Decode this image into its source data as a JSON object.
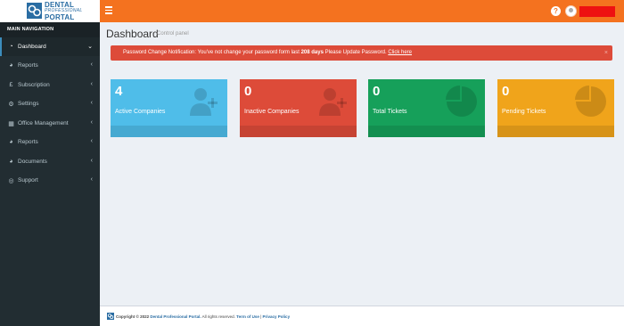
{
  "brand": {
    "line1": "DENTAL",
    "line2": "PROFESSIONAL",
    "line3": "PORTAL"
  },
  "topbar": {
    "help_symbol": "?",
    "accent_color": "#f4721f"
  },
  "sidebar": {
    "header": "MAIN NAVIGATION",
    "items": [
      {
        "label": "Dashboard",
        "icon": "dashboard-icon"
      },
      {
        "label": "Reports",
        "icon": "pie-chart-icon"
      },
      {
        "label": "Subscription",
        "icon": "pound-icon"
      },
      {
        "label": "Settings",
        "icon": "gear-icon"
      },
      {
        "label": "Office Management",
        "icon": "building-icon"
      },
      {
        "label": "Reports",
        "icon": "pie-chart-icon"
      },
      {
        "label": "Documents",
        "icon": "pie-chart-icon"
      },
      {
        "label": "Support",
        "icon": "life-ring-icon"
      }
    ]
  },
  "page": {
    "title": "Dashboard",
    "subtitle": "Control panel"
  },
  "alert": {
    "text_before": "Password Change Notification: You've not change your password form last ",
    "days": "208 days",
    "text_after": " Please Update Password. ",
    "link": "Click here",
    "close": "×"
  },
  "stats": [
    {
      "value": "4",
      "label": "Active Companies",
      "color": "#4fbde9"
    },
    {
      "value": "0",
      "label": "Inactive Companies",
      "color": "#dd4b39"
    },
    {
      "value": "0",
      "label": "Total Tickets",
      "color": "#16a05a"
    },
    {
      "value": "0",
      "label": "Pending Tickets",
      "color": "#f0a41b"
    }
  ],
  "footer": {
    "copyright": "Copyright © 2022",
    "company": "Dental Professional Portal.",
    "rights": "All rights reserved.",
    "terms": "Term of Use",
    "separator": "|",
    "privacy": "Privacy Policy"
  }
}
